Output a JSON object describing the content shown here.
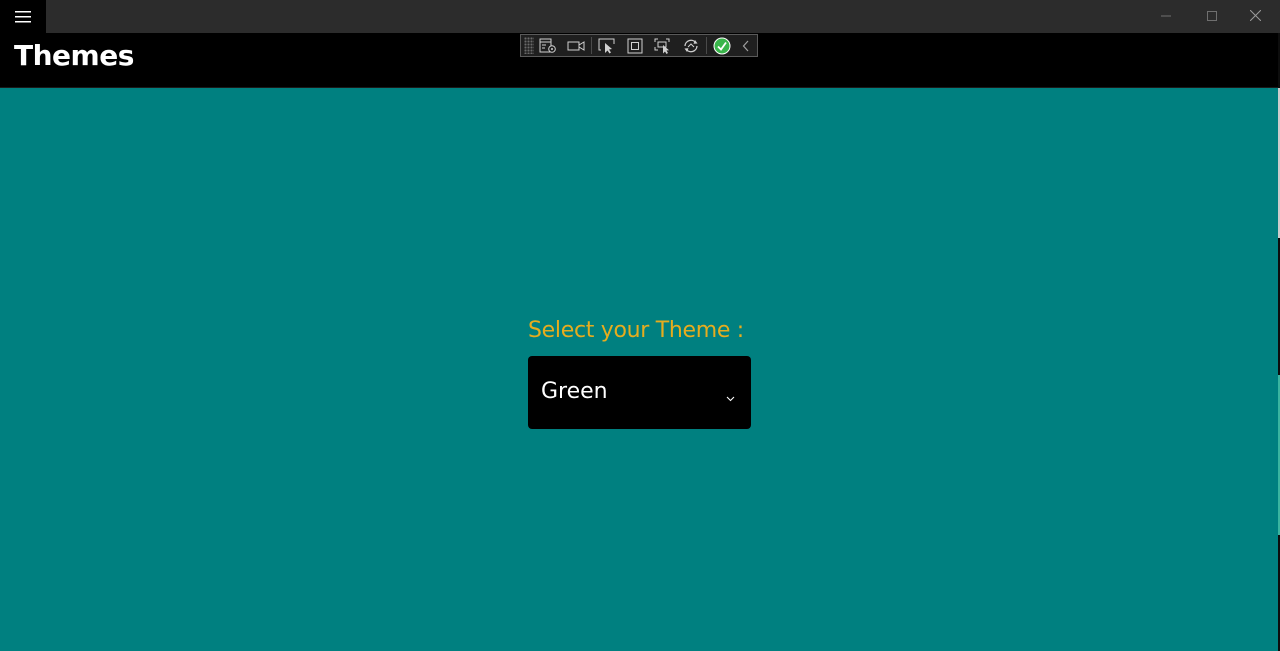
{
  "window": {
    "title": "Themes",
    "menu_icon": "hamburger-menu-icon",
    "controls": [
      "minimize-icon",
      "maximize-icon",
      "close-icon"
    ]
  },
  "debug_toolbar": {
    "icons": [
      "live-visual-tree-icon",
      "camera-icon",
      "select-element-icon",
      "display-layout-adorners-icon",
      "track-focus-icon",
      "hot-reload-icon",
      "check-status-icon",
      "collapse-chevron-icon"
    ]
  },
  "main": {
    "label": "Select your Theme :",
    "picker": {
      "selected": "Green",
      "icon": "chevron-down-icon"
    }
  },
  "colors": {
    "background": "#008080",
    "header": "#000000",
    "label": "#E6AC1E",
    "picker_bg": "#000000",
    "picker_text": "#FFFFFF"
  }
}
